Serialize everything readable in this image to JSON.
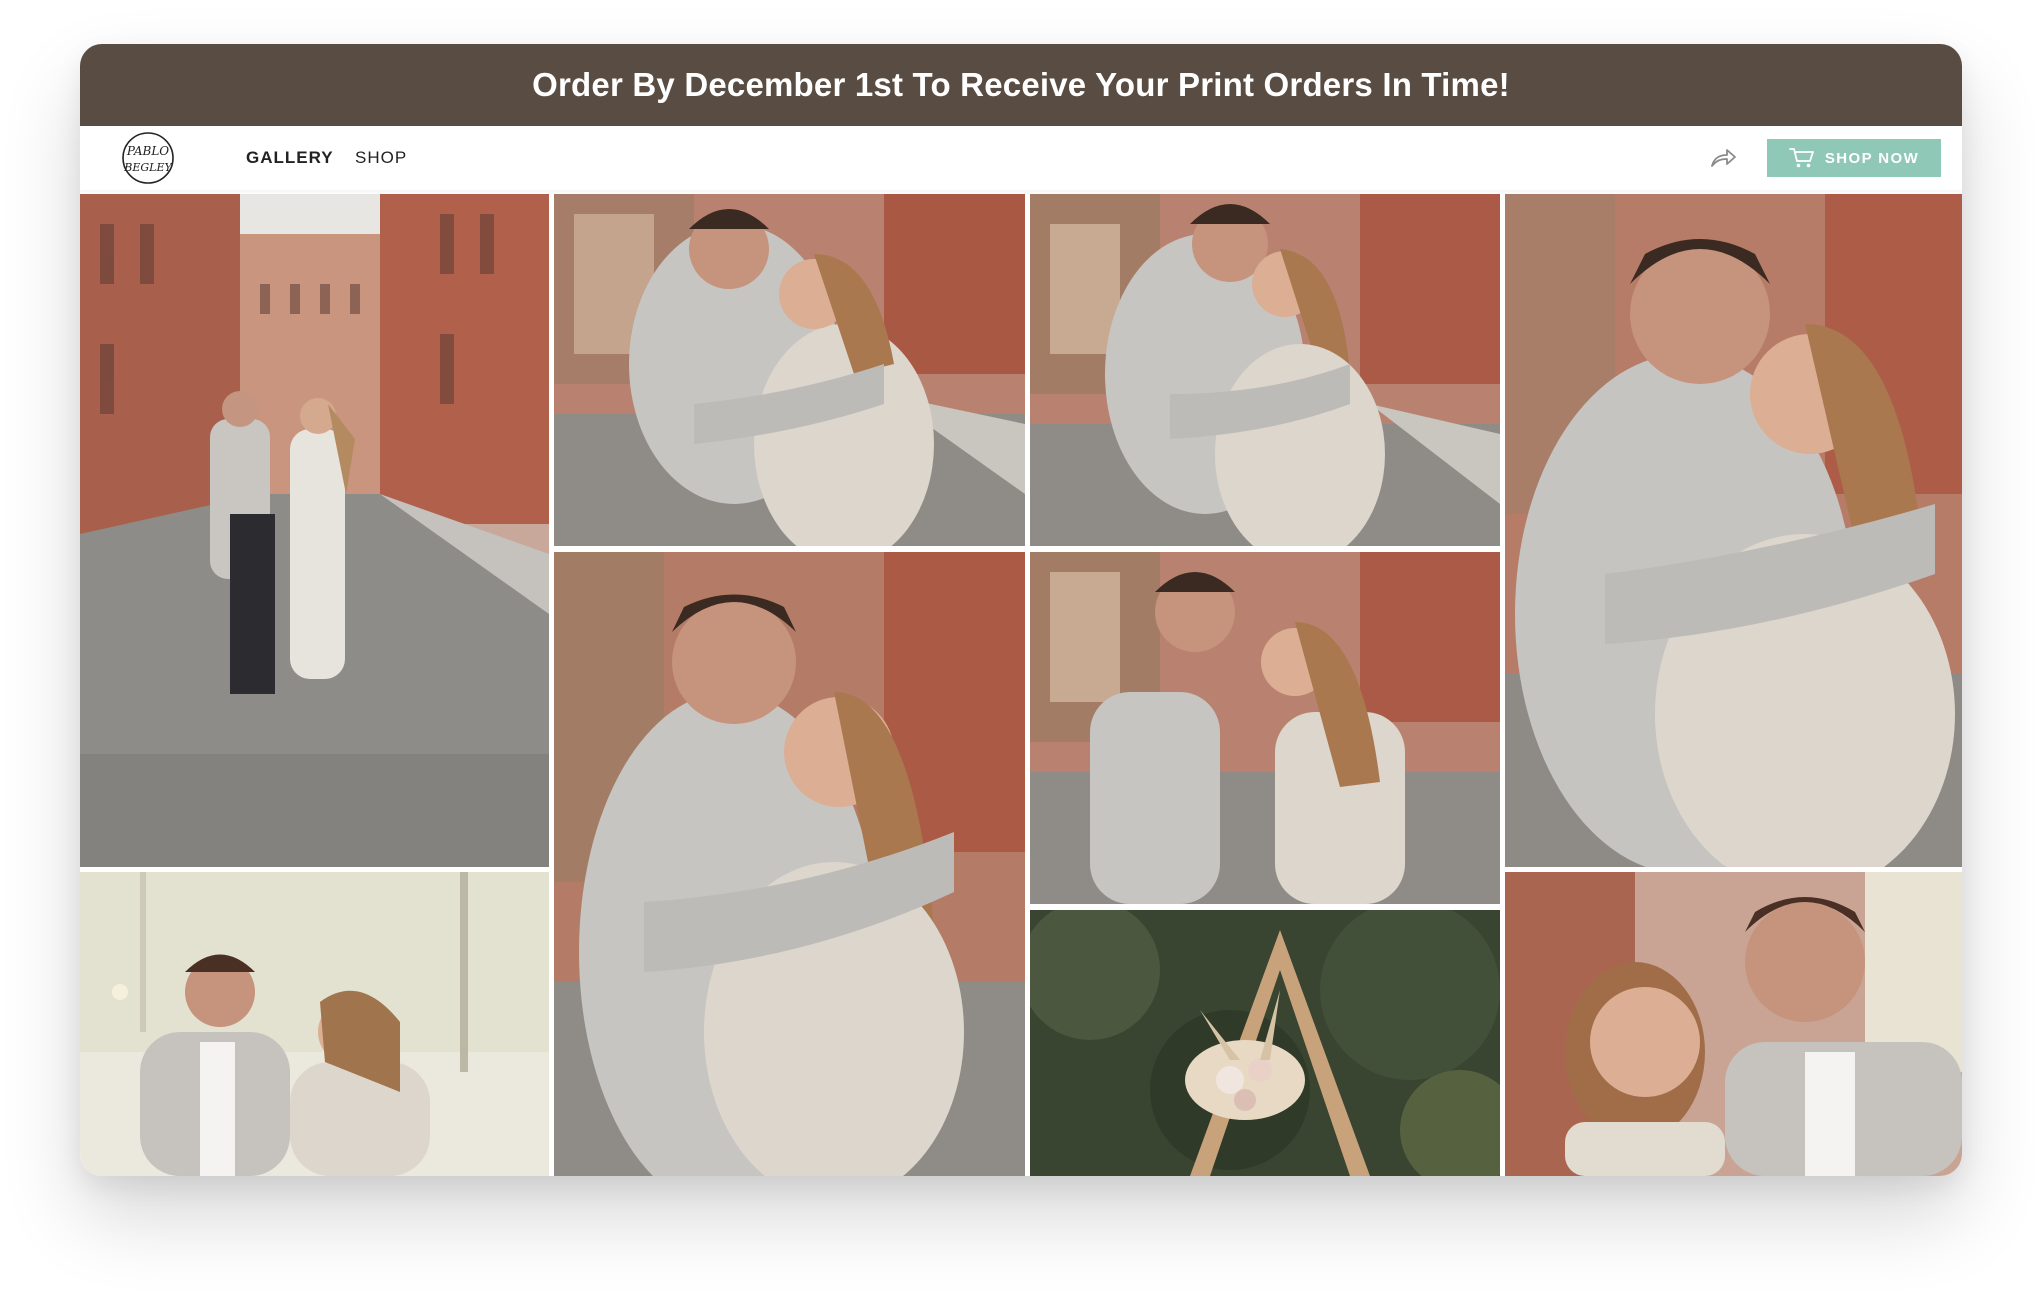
{
  "banner": {
    "text": "Order By December 1st To Receive Your Print Orders In Time!"
  },
  "brand": {
    "logo_line1": "PABLO",
    "logo_line2": "BEGLEY"
  },
  "nav": {
    "items": [
      {
        "label": "GALLERY",
        "active": true
      },
      {
        "label": "SHOP",
        "active": false
      }
    ]
  },
  "actions": {
    "share_icon": "share-arrow-icon",
    "shop_now_label": "SHOP NOW",
    "shop_now_icon": "cart-icon"
  },
  "colors": {
    "banner_bg": "#594c43",
    "shop_now_bg": "#8fc8b7"
  },
  "gallery": {
    "photos": [
      {
        "subject": "couple walking on cobblestone street between brick buildings"
      },
      {
        "subject": "couple embracing and smiling in street"
      },
      {
        "subject": "couple embracing cheek to cheek in street"
      },
      {
        "subject": "close-up couple embracing"
      },
      {
        "subject": "close-up couple hugging and laughing"
      },
      {
        "subject": "couple face to face smiling"
      },
      {
        "subject": "couple in park, soft light"
      },
      {
        "subject": "wooden arch with pampas grass floral arrangement"
      },
      {
        "subject": "close-up man kissing woman's forehead"
      }
    ]
  }
}
